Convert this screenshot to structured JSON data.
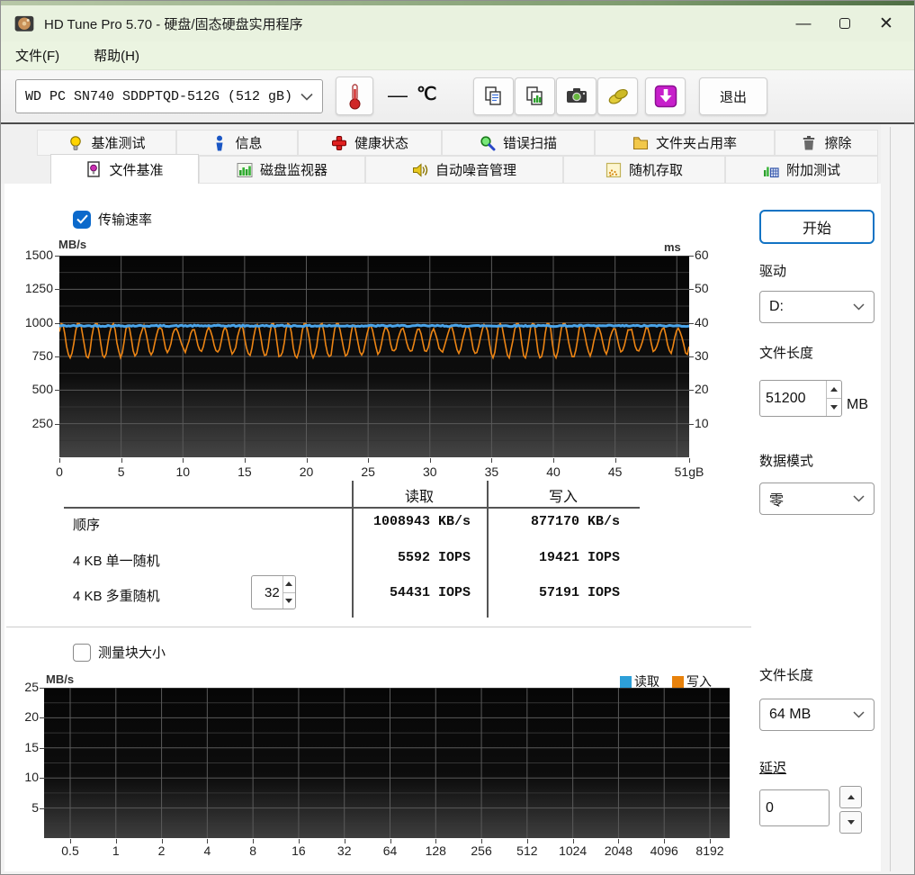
{
  "window": {
    "title": "HD Tune Pro 5.70 - 硬盘/固态硬盘实用程序",
    "controls": {
      "minimize": "—",
      "close": "✕"
    }
  },
  "menu": {
    "items": [
      {
        "label": "文件(F)"
      },
      {
        "label": "帮助(H)"
      }
    ]
  },
  "toolbar": {
    "drive_selector": {
      "value": "WD PC SN740 SDDPTQD-512G (512 gB)"
    },
    "temperature": {
      "value": "—",
      "unit": "℃"
    },
    "exit_label": "退出"
  },
  "tabs": {
    "row1": [
      {
        "label": "基准测试"
      },
      {
        "label": "信息"
      },
      {
        "label": "健康状态"
      },
      {
        "label": "错误扫描"
      },
      {
        "label": "文件夹占用率"
      },
      {
        "label": "擦除"
      }
    ],
    "row2": [
      {
        "label": "文件基准",
        "active": true
      },
      {
        "label": "磁盘监视器"
      },
      {
        "label": "自动噪音管理"
      },
      {
        "label": "随机存取"
      },
      {
        "label": "附加测试"
      }
    ]
  },
  "file_benchmark": {
    "transfer_rate_checkbox": {
      "label": "传输速率",
      "checked": true
    },
    "block_size_checkbox": {
      "label": "测量块大小",
      "checked": false
    },
    "results": {
      "columns": [
        "读取",
        "写入"
      ],
      "rows": [
        {
          "label": "顺序",
          "read": "1008943 KB/s",
          "write": "877170 KB/s"
        },
        {
          "label": "4 KB 单一随机",
          "read": "5592 IOPS",
          "write": "19421 IOPS"
        },
        {
          "label": "4 KB 多重随机",
          "queue_depth": "32",
          "read": "54431 IOPS",
          "write": "57191 IOPS"
        }
      ]
    }
  },
  "sidebar": {
    "start_button": "开始",
    "drive_label": "驱动",
    "drive_value": "D:",
    "file_length_label": "文件长度",
    "file_length_value": "51200",
    "file_length_unit": "MB",
    "data_mode_label": "数据模式",
    "data_mode_value": "零",
    "file_length2_label": "文件长度",
    "file_length2_value": "64 MB",
    "delay_label": "延迟",
    "delay_value": "0"
  },
  "chart_data": [
    {
      "type": "line",
      "ylabel_left": "MB/s",
      "ylabel_right": "ms",
      "ylim_left": [
        0,
        1500
      ],
      "ylim_right": [
        0,
        61
      ],
      "y_ticks_left": [
        250,
        500,
        750,
        1000,
        1250,
        1500
      ],
      "y_ticks_right": [
        10,
        20,
        30,
        40,
        50,
        60
      ],
      "xlim": [
        0,
        51
      ],
      "x_ticks": [
        {
          "value": 0,
          "label": "0"
        },
        {
          "value": 5,
          "label": "5"
        },
        {
          "value": 10,
          "label": "10"
        },
        {
          "value": 15,
          "label": "15"
        },
        {
          "value": 20,
          "label": "20"
        },
        {
          "value": 25,
          "label": "25"
        },
        {
          "value": 30,
          "label": "30"
        },
        {
          "value": 35,
          "label": "35"
        },
        {
          "value": 40,
          "label": "40"
        },
        {
          "value": 45,
          "label": "45"
        },
        {
          "value": 51,
          "label": "51gB"
        }
      ],
      "grid": true,
      "background": "black-gradient",
      "series": [
        {
          "name": "读取",
          "color": "#4aa3e8",
          "shape": "flat",
          "approx_mbs": 978,
          "noise_mbs": 10
        },
        {
          "name": "写入",
          "color": "#ed8514",
          "shape": "oscillating",
          "min_mbs": 740,
          "max_mbs": 995,
          "mean_mbs": 872
        }
      ]
    },
    {
      "type": "line",
      "ylabel_left": "MB/s",
      "ylim_left": [
        0,
        25
      ],
      "y_ticks_left": [
        5,
        10,
        15,
        20,
        25
      ],
      "x_ticks": [
        "0.5",
        "1",
        "2",
        "4",
        "8",
        "16",
        "32",
        "64",
        "128",
        "256",
        "512",
        "1024",
        "2048",
        "4096",
        "8192"
      ],
      "grid": true,
      "background": "black-gradient",
      "legend": [
        {
          "label": "读取",
          "color": "#2d9fd8"
        },
        {
          "label": "写入",
          "color": "#e8820c"
        }
      ],
      "series": []
    }
  ]
}
